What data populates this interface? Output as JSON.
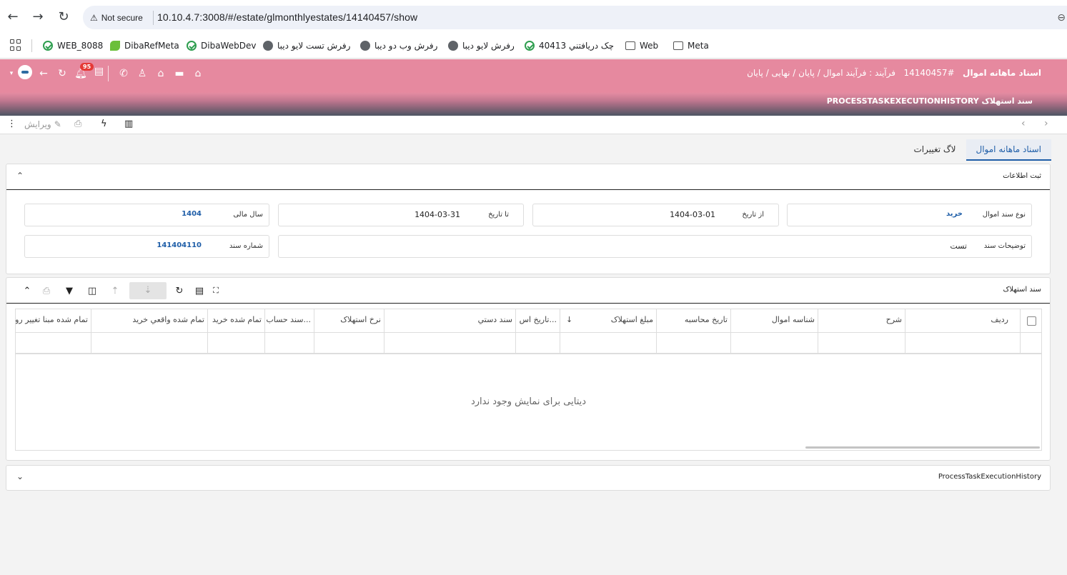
{
  "browser": {
    "security_label": "Not secure",
    "url": "10.10.4.7:3008/#/estate/glmonthlyestates/14140457/show",
    "bookmarks": [
      {
        "label": "WEB_8088",
        "icon": "green-check"
      },
      {
        "label": "DibaRefMeta",
        "icon": "leaf"
      },
      {
        "label": "DibaWebDev",
        "icon": "green-check"
      },
      {
        "label": "رفرش تست لایو دیبا",
        "icon": "globe"
      },
      {
        "label": "رفرش وب دو دیبا",
        "icon": "globe"
      },
      {
        "label": "رفرش لایو دیبا",
        "icon": "globe"
      },
      {
        "label": "چک دريافتني 40413",
        "icon": "green-check"
      },
      {
        "label": "Web",
        "icon": "folder"
      },
      {
        "label": "Meta",
        "icon": "folder"
      }
    ]
  },
  "header": {
    "title": "اسناد ماهانه اموال",
    "record_id": "#14140457",
    "process_path": "فرآیند : فرآیند اموال / پایان / نهایی / پایان",
    "sub_items": [
      "سند استهلاک",
      "PROCESSTASKEXECUTIONHISTORY"
    ],
    "notification_count": "95",
    "accent_color": "#e6899f"
  },
  "toolbar": {
    "edit_label": "ویرایش"
  },
  "tabs": [
    {
      "label": "اسناد ماهانه اموال",
      "active": true
    },
    {
      "label": "لاگ تغییرات",
      "active": false
    }
  ],
  "info_panel": {
    "title": "ثبت اطلاعات",
    "fields": {
      "doc_type": {
        "label": "نوع سند اموال",
        "value": "خرید"
      },
      "from_date": {
        "label": "از تاریخ",
        "value": "1404-03-01"
      },
      "to_date": {
        "label": "تا تاریخ",
        "value": "1404-03-31"
      },
      "fiscal_year": {
        "label": "سال مالی",
        "value": "1404"
      },
      "description": {
        "label": "توضیحات سند",
        "value": "تست"
      },
      "doc_number": {
        "label": "شماره سند",
        "value": "141404110"
      }
    }
  },
  "grid_panel": {
    "title": "سند استهلاک",
    "columns": [
      "ردیف",
      "شرح",
      "شناسه اموال",
      "تاریخ محاسبه",
      "مبلغ استهلاک",
      "تاریخ اس...",
      "سند دستي",
      "نرخ استهلاک",
      "سند حساب...",
      "تمام شده خرید",
      "تمام شده واقعي خرید",
      "تمام شده مبنا تغییر روش"
    ],
    "empty_message": "دیتایی برای نمایش وجود ندارد"
  },
  "history_panel": {
    "title": "ProcessTaskExecutionHistory"
  }
}
